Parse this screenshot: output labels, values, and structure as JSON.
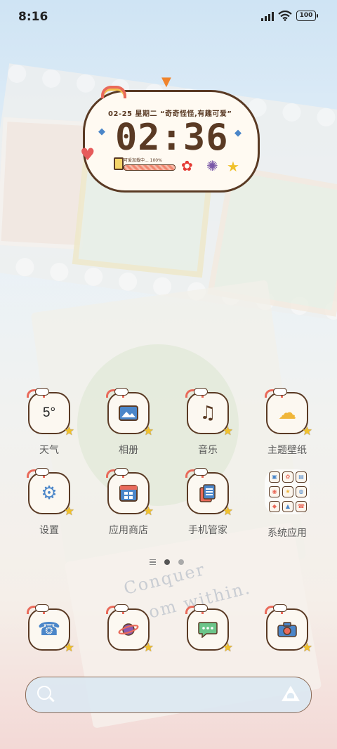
{
  "status_bar": {
    "time": "8:16",
    "battery": "100"
  },
  "clock_widget": {
    "date_line": "02-25  星期二  “奇奇怪怪,有趣可爱”",
    "time": "02:36",
    "loading_text": "可爱加载中... 100%",
    "progress": 1.0
  },
  "apps": [
    {
      "id": "weather",
      "label": "天气",
      "glyph": "5°",
      "icon": "weather-icon"
    },
    {
      "id": "gallery",
      "label": "相册",
      "glyph": "🖼",
      "icon": "gallery-icon"
    },
    {
      "id": "music",
      "label": "音乐",
      "glyph": "♫",
      "icon": "music-note-icon"
    },
    {
      "id": "themes",
      "label": "主题壁纸",
      "glyph": "☁",
      "icon": "theme-icon"
    },
    {
      "id": "settings",
      "label": "设置",
      "glyph": "⚙",
      "icon": "gear-icon"
    },
    {
      "id": "appstore",
      "label": "应用商店",
      "glyph": "▦",
      "icon": "app-store-icon"
    },
    {
      "id": "security",
      "label": "手机管家",
      "glyph": "▤",
      "icon": "phone-manager-icon"
    },
    {
      "id": "system_apps",
      "label": "系统应用",
      "icon": "folder-icon"
    }
  ],
  "dock": [
    {
      "id": "phone",
      "glyph": "☎",
      "icon": "phone-icon"
    },
    {
      "id": "browser",
      "glyph": "🪐",
      "icon": "planet-browser-icon"
    },
    {
      "id": "messages",
      "glyph": "💬",
      "icon": "message-bubble-icon"
    },
    {
      "id": "camera",
      "glyph": "📷",
      "icon": "camera-icon"
    }
  ],
  "pager": {
    "pages": 2,
    "current": 1
  },
  "wallpaper": {
    "slogan_line1": "Conquer",
    "slogan_line2": "om within."
  }
}
